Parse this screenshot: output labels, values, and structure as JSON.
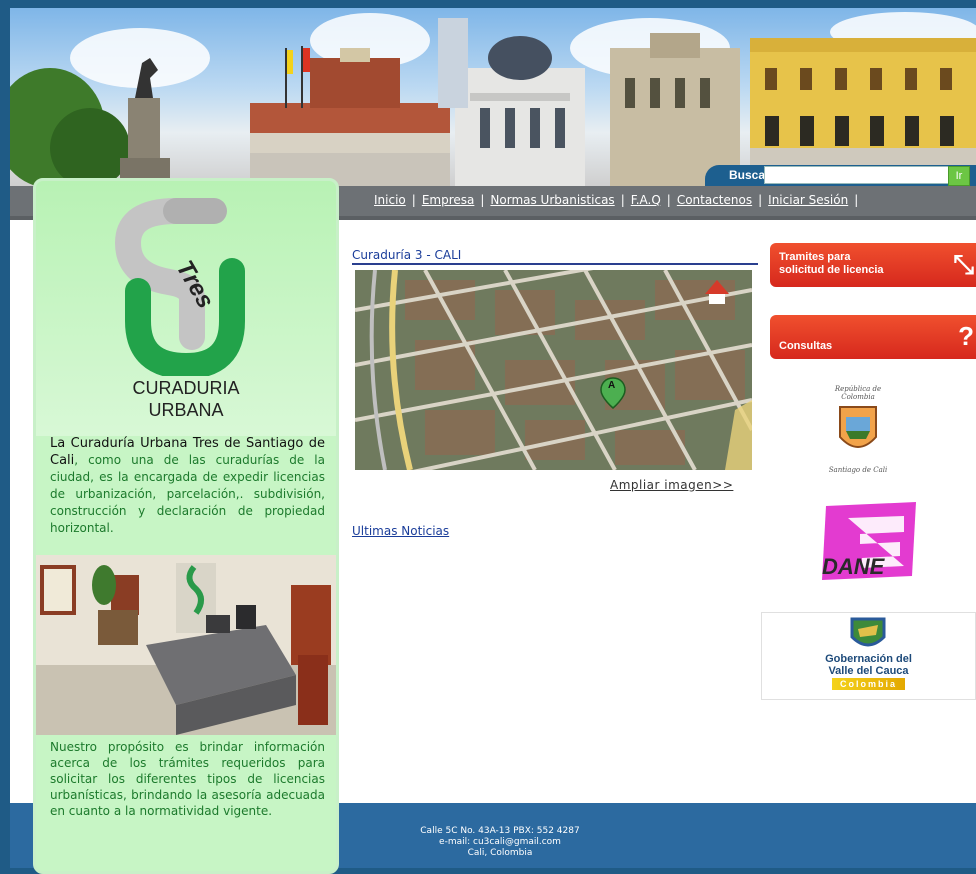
{
  "search": {
    "label": "Buscar",
    "value": "",
    "go_label": "Ir"
  },
  "nav": {
    "items": [
      "Inicio",
      "Empresa",
      "Normas Urbanisticas",
      "F.A.Q",
      "Contactenos",
      "Iniciar Sesión"
    ],
    "separator": "|"
  },
  "sidebar": {
    "logo_word": "Tres",
    "logo_line1": "CURADURIA",
    "logo_line2": "URBANA",
    "intro_dark": "La Curaduría Urbana Tres de Santiago de Cali",
    "intro_rest": ", como una de las curadurías de la ciudad, es la encargada de expedir licencias de urbanización, parcelación,. subdivisión, construcción y declaración de propiedad horizontal.",
    "purpose": "Nuestro propósito es brindar información acerca de los trámites requeridos para solicitar los diferentes tipos de licencias urbanísticas, brindando la asesoría adecuada en cuanto a la normatividad vigente."
  },
  "main": {
    "map_title": "Curaduría 3 - CALI",
    "map_marker": "A",
    "enlarge_link": "Ampliar imagen>>",
    "news_link": "Ultimas Noticias"
  },
  "right": {
    "tramites_label_1": "Tramites para",
    "tramites_label_2": "solicitud de licencia",
    "consultas_label": "Consultas",
    "cali_seal_text_1": "República de Colombia",
    "cali_seal_text_2": "Santiago de Cali",
    "dane_label": "DANE",
    "valle_label_1": "Gobernación del",
    "valle_label_2": "Valle del Cauca",
    "valle_label_3": "Colombia"
  },
  "footer": {
    "line1": "Calle 5C No. 43A-13 PBX: 552 4287",
    "line2": "e-mail: cu3cali@gmail.com",
    "line3": "Cali, Colombia"
  },
  "colors": {
    "accent_green": "#1c7a2c",
    "nav_gray": "#6d7175",
    "footer_blue": "#2c6aa0",
    "button_red": "#e03a24"
  }
}
